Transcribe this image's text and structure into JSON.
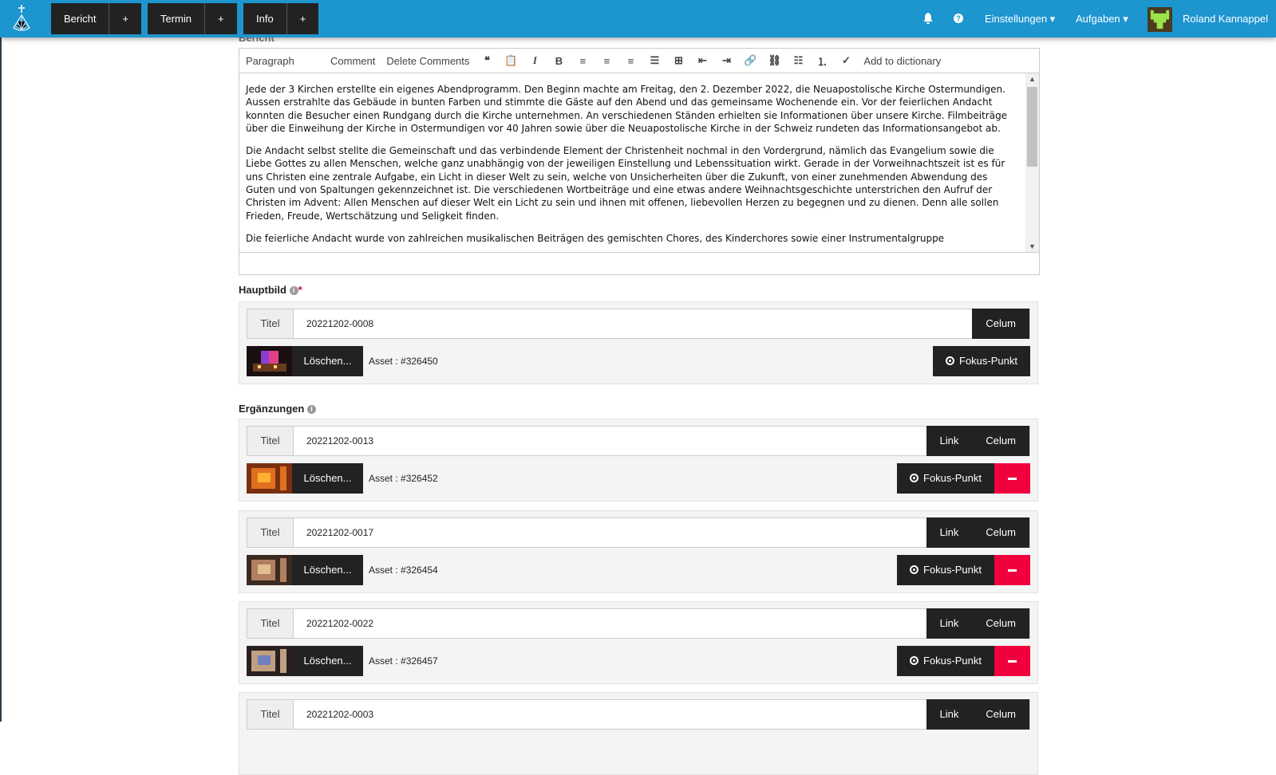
{
  "nav": {
    "groups": [
      {
        "label": "Bericht",
        "add": "+"
      },
      {
        "label": "Termin",
        "add": "+"
      },
      {
        "label": "Info",
        "add": "+"
      }
    ],
    "right": {
      "bell": "bell-icon",
      "help": "?",
      "settings": "Einstellungen ▾",
      "tasks": "Aufgaben ▾",
      "user": "Roland Kannappel"
    }
  },
  "editor": {
    "label": "Bericht",
    "toolbar": {
      "format": "Paragraph",
      "comment": "Comment",
      "delete_comments": "Delete Comments",
      "dictionary": "Add to dictionary"
    },
    "paragraphs": [
      "Jede der 3 Kirchen erstellte ein eigenes Abendprogramm. Den Beginn machte am Freitag, den 2. Dezember 2022, die Neuapostolische Kirche Ostermundigen. Aussen erstrahlte das Gebäude in bunten Farben und stimmte die Gäste auf den Abend und das gemeinsame Wochenende ein. Vor der feierlichen Andacht konnten die Besucher einen Rundgang durch die Kirche unternehmen. An verschiedenen Ständen erhielten sie Informationen über unsere Kirche. Filmbeiträge über die Einweihung der Kirche in Ostermundigen vor 40 Jahren sowie über die Neuapostolische Kirche in der Schweiz rundeten das Informationsangebot ab.",
      "Die Andacht selbst stellte die Gemeinschaft und das verbindende Element der Christenheit nochmal in den Vordergrund, nämlich das Evangelium sowie die Liebe Gottes zu allen Menschen, welche ganz unabhängig von der jeweiligen Einstellung und Lebenssituation wirkt. Gerade in der Vorweihnachtszeit ist es für uns Christen eine zentrale Aufgabe, ein Licht in dieser Welt zu sein, welche von Unsicherheiten über die Zukunft, von einer zunehmenden Abwendung des Guten und von Spaltungen gekennzeichnet ist. Die verschiedenen Wortbeiträge und  eine etwas andere Weihnachtsgeschichte unterstrichen den Aufruf der Christen im Advent: Allen Menschen auf dieser Welt ein Licht zu sein und ihnen mit offenen, liebevollen Herzen zu begegnen und zu dienen. Denn alle sollen Frieden, Freude, Wertschätzung und Seligkeit finden.",
      "Die feierliche Andacht wurde von zahlreichen musikalischen Beiträgen des gemischten Chores, des Kinderchores sowie einer Instrumentalgruppe"
    ]
  },
  "hauptbild": {
    "label": "Hauptbild",
    "required": "*",
    "addon": "Titel",
    "value": "20221202-0008",
    "celum": "Celum",
    "delete": "Löschen...",
    "asset": "Asset : #326450",
    "fokus": "Fokus-Punkt"
  },
  "ergaenzungen": {
    "label": "Ergänzungen",
    "items": [
      {
        "addon": "Titel",
        "value": "20221202-0013",
        "link": "Link",
        "celum": "Celum",
        "delete": "Löschen...",
        "asset": "Asset : #326452",
        "fokus": "Fokus-Punkt"
      },
      {
        "addon": "Titel",
        "value": "20221202-0017",
        "link": "Link",
        "celum": "Celum",
        "delete": "Löschen...",
        "asset": "Asset : #326454",
        "fokus": "Fokus-Punkt"
      },
      {
        "addon": "Titel",
        "value": "20221202-0022",
        "link": "Link",
        "celum": "Celum",
        "delete": "Löschen...",
        "asset": "Asset : #326457",
        "fokus": "Fokus-Punkt"
      },
      {
        "addon": "Titel",
        "value": "20221202-0003",
        "link": "Link",
        "celum": "Celum"
      }
    ]
  },
  "colors": {
    "nav": "#1d95cf",
    "button": "#222222",
    "danger": "#f0003c"
  }
}
